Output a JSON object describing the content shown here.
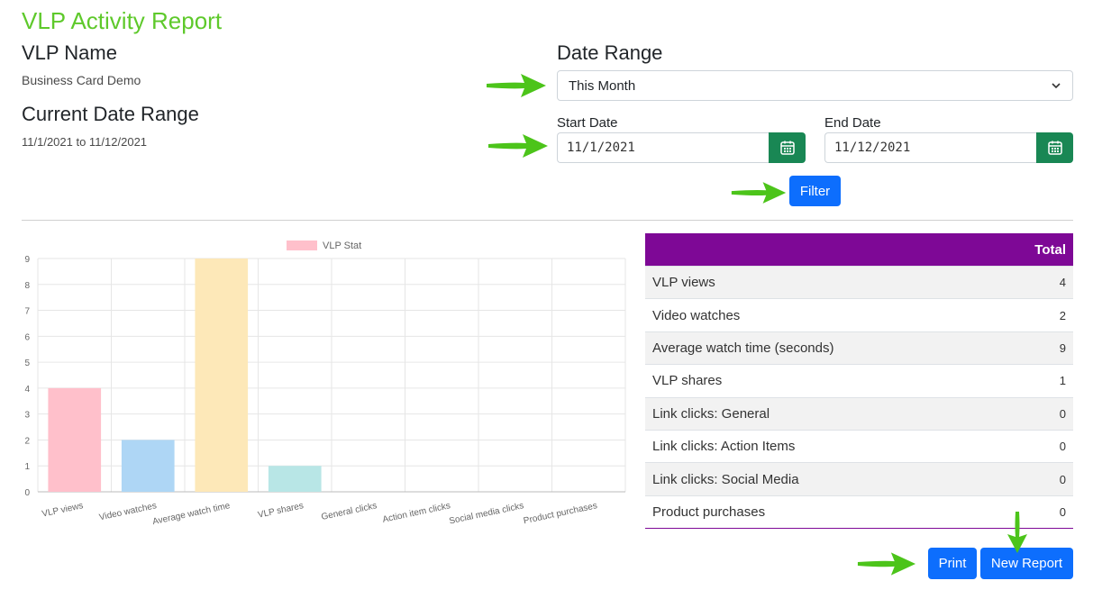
{
  "header": {
    "title": "VLP Activity Report"
  },
  "vlp": {
    "name_heading": "VLP Name",
    "name_value": "Business Card Demo"
  },
  "current_range": {
    "heading": "Current Date Range",
    "value": "11/1/2021 to 11/12/2021"
  },
  "date_range": {
    "heading": "Date Range",
    "selected": "This Month"
  },
  "start_date": {
    "label": "Start Date",
    "value": "11/1/2021"
  },
  "end_date": {
    "label": "End Date",
    "value": "11/12/2021"
  },
  "buttons": {
    "filter": "Filter",
    "print": "Print",
    "new_report": "New Report"
  },
  "table": {
    "header": "Total",
    "rows": [
      {
        "label": "VLP views",
        "value": "4"
      },
      {
        "label": "Video watches",
        "value": "2"
      },
      {
        "label": "Average watch time (seconds)",
        "value": "9"
      },
      {
        "label": "VLP shares",
        "value": "1"
      },
      {
        "label": "Link clicks: General",
        "value": "0"
      },
      {
        "label": "Link clicks: Action Items",
        "value": "0"
      },
      {
        "label": "Link clicks: Social Media",
        "value": "0"
      },
      {
        "label": "Product purchases",
        "value": "0"
      }
    ]
  },
  "colors": {
    "title_green": "#5ec92b",
    "purple": "#7e0896",
    "blue": "#0d6efd",
    "green_btn": "#198754",
    "arrow_green": "#4cc41a"
  },
  "chart_data": {
    "type": "bar",
    "categories": [
      "VLP views",
      "Video watches",
      "Average watch time",
      "VLP shares",
      "General clicks",
      "Action item clicks",
      "Social media clicks",
      "Product purchases"
    ],
    "series": [
      {
        "name": "VLP Stat",
        "values": [
          4,
          2,
          9,
          1,
          0,
          0,
          0,
          0
        ]
      }
    ],
    "bar_colors": [
      "#ffc0cb",
      "#aed6f5",
      "#fde8b8",
      "#b8e6e6",
      "#e0e0e0",
      "#e0e0e0",
      "#e0e0e0",
      "#e0e0e0"
    ],
    "yticks": [
      "0",
      "1",
      "2",
      "3",
      "4",
      "5",
      "6",
      "7",
      "8",
      "9"
    ],
    "ylim": [
      0,
      9
    ],
    "grid": true,
    "legend": "top"
  }
}
